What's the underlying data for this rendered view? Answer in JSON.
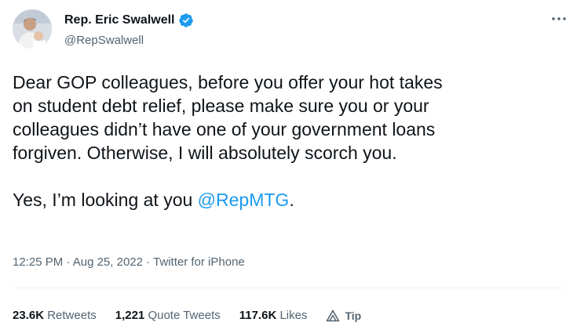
{
  "user": {
    "name": "Rep. Eric Swalwell",
    "handle": "@RepSwalwell",
    "verified_color": "#1d9bf0"
  },
  "tweet": {
    "lines": [
      "Dear GOP colleagues, before you offer your hot takes",
      "on student debt relief, please make sure you or your",
      "colleagues didn’t have one of your government loans",
      "forgiven. Otherwise, I will absolutely scorch you."
    ],
    "line_last_prefix": "Yes, I’m looking at you ",
    "mention": "@RepMTG",
    "line_last_suffix": "."
  },
  "meta": {
    "time": "12:25 PM",
    "sep1": " · ",
    "date": "Aug 25, 2022",
    "sep2": " · ",
    "source": "Twitter for iPhone"
  },
  "stats": {
    "retweets_count": "23.6K",
    "retweets_label": "Retweets",
    "quotes_count": "1,221",
    "quotes_label": "Quote Tweets",
    "likes_count": "117.6K",
    "likes_label": "Likes",
    "tip_label": "Tip"
  },
  "icons": {
    "more": "more-horizontal-icon",
    "verified": "verified-badge-icon",
    "tip": "tip-icon"
  },
  "colors": {
    "text": "#0f1419",
    "secondary": "#536471",
    "link": "#1d9bf0",
    "divider": "#eff3f4"
  }
}
